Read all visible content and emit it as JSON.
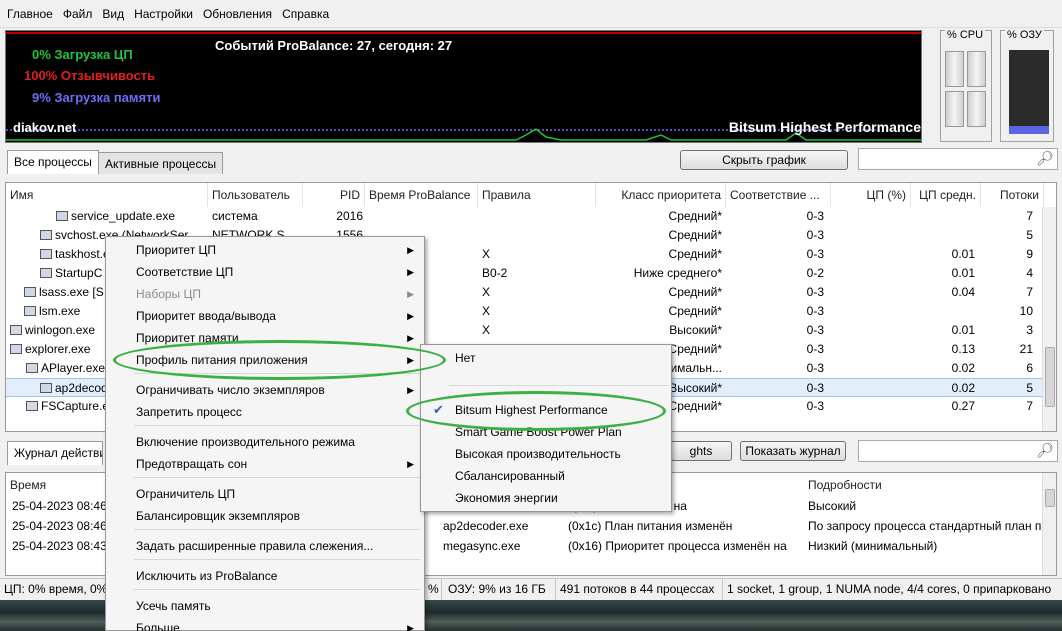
{
  "menubar": [
    "Главное",
    "Файл",
    "Вид",
    "Настройки",
    "Обновления",
    "Справка"
  ],
  "graph": {
    "cpu_load": "0% Загрузка ЦП",
    "responsiveness": "100% Отзывчивость",
    "memory_load": "9% Загрузка памяти",
    "events": "Событий ProBalance: 27, сегодня: 27",
    "site": "diakov.net",
    "power_plan": "Bitsum Highest Performance",
    "colors": {
      "cpu": "#21c43a",
      "resp": "#e02020",
      "mem": "#6d6df5",
      "line": "#c00000"
    }
  },
  "meters": {
    "cpu_title": "% CPU",
    "ram_title": "% ОЗУ",
    "ram_percent": 9
  },
  "tabs": {
    "all": "Все процессы",
    "active": "Активные процессы",
    "hide_graph": "Скрыть график"
  },
  "columns": [
    "Имя",
    "Пользователь",
    "PID",
    "Время ProBalance",
    "Правила",
    "Класс приоритета",
    "Соответствие ...",
    "ЦП (%)",
    "ЦП средн.",
    "Потоки"
  ],
  "processes": [
    {
      "name": "service_update.exe",
      "user": "система",
      "pid": "2016",
      "rules": "",
      "prio": "Средний*",
      "aff": "0-3",
      "cpu": "",
      "avg": "",
      "thr": "7"
    },
    {
      "name": "svchost.exe (NetworkSer...",
      "user": "NETWORK S...",
      "pid": "1556",
      "rules": "",
      "prio": "Средний*",
      "aff": "0-3",
      "cpu": "",
      "avg": "",
      "thr": "5"
    },
    {
      "name": "taskhost.exe",
      "user": "",
      "pid": "",
      "rules": "X",
      "prio": "Средний*",
      "aff": "0-3",
      "cpu": "",
      "avg": "0.01",
      "thr": "9"
    },
    {
      "name": "StartupC",
      "user": "",
      "pid": "",
      "rules": "B0-2",
      "prio": "Ниже среднего*",
      "aff": "0-2",
      "cpu": "",
      "avg": "0.01",
      "thr": "4"
    },
    {
      "name": "lsass.exe [S",
      "user": "",
      "pid": "",
      "rules": "X",
      "prio": "Средний*",
      "aff": "0-3",
      "cpu": "",
      "avg": "0.04",
      "thr": "7"
    },
    {
      "name": "lsm.exe",
      "user": "",
      "pid": "",
      "rules": "X",
      "prio": "Средний*",
      "aff": "0-3",
      "cpu": "",
      "avg": "",
      "thr": "10"
    },
    {
      "name": "winlogon.exe",
      "user": "",
      "pid": "",
      "rules": "X",
      "prio": "Высокий*",
      "aff": "0-3",
      "cpu": "",
      "avg": "0.01",
      "thr": "3"
    },
    {
      "name": "explorer.exe",
      "user": "",
      "pid": "",
      "rules": "",
      "prio": "Средний*",
      "aff": "0-3",
      "cpu": "",
      "avg": "0.13",
      "thr": "21"
    },
    {
      "name": "APlayer.exe",
      "user": "",
      "pid": "",
      "rules": "",
      "prio": "Минимальн...",
      "aff": "0-3",
      "cpu": "",
      "avg": "0.02",
      "thr": "6"
    },
    {
      "name": "ap2decoder.exe",
      "user": "",
      "pid": "",
      "rules": "",
      "prio": "Высокий*",
      "aff": "0-3",
      "cpu": "",
      "avg": "0.02",
      "thr": "5"
    },
    {
      "name": "FSCapture.exe",
      "user": "",
      "pid": "",
      "rules": "",
      "prio": "Средний*",
      "aff": "0-3",
      "cpu": "",
      "avg": "0.27",
      "thr": "7"
    }
  ],
  "log": {
    "tab": "Журнал действий",
    "lights_btn": "ghts",
    "show_log_btn": "Показать журнал",
    "columns": {
      "time": "Время",
      "details": "Подробности"
    },
    "rows": [
      {
        "time": "25-04-2023 08:46",
        "proc": "",
        "action": "процесса изменён на",
        "details": "Высокий"
      },
      {
        "time": "25-04-2023 08:46",
        "proc": "ap2decoder.exe",
        "action": "(0x1c) План питания изменён",
        "details": "По запросу процесса стандартный план пи"
      },
      {
        "time": "25-04-2023 08:43",
        "proc": "megasync.exe",
        "action": "(0x16) Приоритет процесса изменён на",
        "details": "Низкий (минимальный)"
      }
    ]
  },
  "status": {
    "cpu": "ЦП: 0% время, 0%",
    "pct": "%",
    "ram": "ОЗУ: 9% из 16 ГБ",
    "threads": "491 потоков в 44 процессах",
    "topology": "1 socket, 1 group, 1 NUMA node, 4/4 cores, 0 припаркованo"
  },
  "context_menu": [
    "Приоритет ЦП",
    "Соответствие ЦП",
    "Наборы ЦП",
    "Приоритет ввода/вывода",
    "Приоритет памяти",
    "Профиль питания приложения",
    "Ограничивать число экземпляров",
    "Запретить процесс",
    "Включение производительного режима",
    "Предотвращать сон",
    "Ограничитель ЦП",
    "Балансировщик экземпляров",
    "Задать расширенные правила слежения...",
    "Исключить из ProBalance",
    "Усечь память",
    "Больше"
  ],
  "submenu": [
    "Нет",
    "Bitsum Highest Performance",
    "Smart Game Boost Power Plan",
    "Высокая производительность",
    "Сбалансированный",
    "Экономия энергии"
  ]
}
